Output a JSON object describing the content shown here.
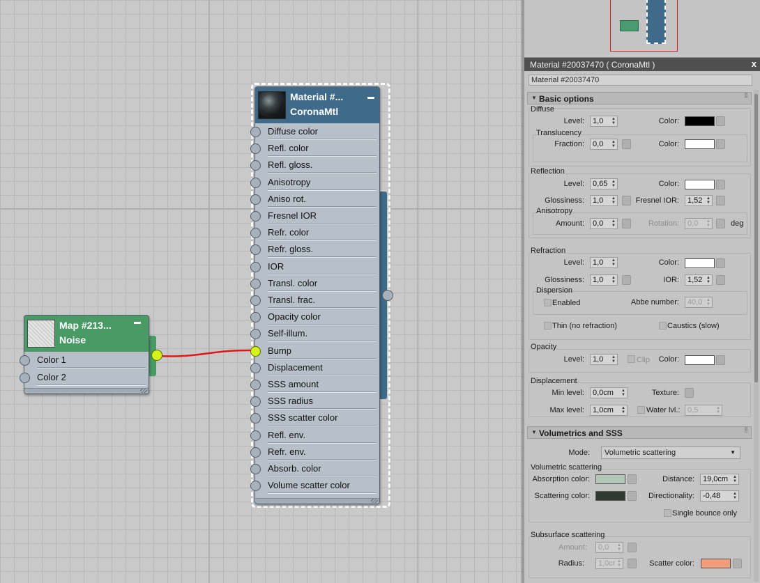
{
  "material_node": {
    "title": "Material  #...",
    "subtitle": "CoronaMtl",
    "slots": [
      "Diffuse color",
      "Refl. color",
      "Refl. gloss.",
      "Anisotropy",
      "Aniso rot.",
      "Fresnel IOR",
      "Refr. color",
      "Refr. gloss.",
      "IOR",
      "Transl. color",
      "Transl. frac.",
      "Opacity color",
      "Self-illum.",
      "Bump",
      "Displacement",
      "SSS amount",
      "SSS radius",
      "SSS scatter color",
      "Refl. env.",
      "Refr. env.",
      "Absorb. color",
      "Volume scatter color"
    ],
    "connected_slot": "Bump"
  },
  "map_node": {
    "title": "Map  #213...",
    "subtitle": "Noise",
    "slots": [
      "Color 1",
      "Color 2"
    ]
  },
  "panel": {
    "title": "Material #20037470  ( CoronaMtl )",
    "close_glyph": "x",
    "material_name": "Material #20037470",
    "basic": {
      "title": "Basic options",
      "diffuse": {
        "header": "Diffuse",
        "level_label": "Level:",
        "level": "1,0",
        "color_label": "Color:",
        "color": "#000000"
      },
      "translucency": {
        "header": "Translucency",
        "fraction_label": "Fraction:",
        "fraction": "0,0",
        "color_label": "Color:",
        "color": "#ffffff"
      },
      "reflection": {
        "header": "Reflection",
        "level_label": "Level:",
        "level": "0,65",
        "color_label": "Color:",
        "color": "#ffffff",
        "gloss_label": "Glossiness:",
        "gloss": "1,0",
        "fresnel_label": "Fresnel IOR:",
        "fresnel": "1,52"
      },
      "anisotropy": {
        "header": "Anisotropy",
        "amount_label": "Amount:",
        "amount": "0,0",
        "rotation_label": "Rotation:",
        "rotation": "0,0",
        "unit": "deg"
      },
      "refraction": {
        "header": "Refraction",
        "level_label": "Level:",
        "level": "1,0",
        "color_label": "Color:",
        "color": "#ffffff",
        "gloss_label": "Glossiness:",
        "gloss": "1,0",
        "ior_label": "IOR:",
        "ior": "1,52"
      },
      "dispersion": {
        "header": "Dispersion",
        "enabled_label": "Enabled",
        "abbe_label": "Abbe number:",
        "abbe": "40,0"
      },
      "thin_label": "Thin (no refraction)",
      "caustics_label": "Caustics (slow)",
      "opacity": {
        "header": "Opacity",
        "level_label": "Level:",
        "level": "1,0",
        "clip_label": "Clip",
        "color_label": "Color:",
        "color": "#ffffff"
      },
      "displacement": {
        "header": "Displacement",
        "min_label": "Min level:",
        "min": "0,0cm",
        "texture_label": "Texture:",
        "max_label": "Max level:",
        "max": "1,0cm",
        "water_label": "Water lvl.:",
        "water": "0,5"
      }
    },
    "volumetrics": {
      "title": "Volumetrics and SSS",
      "mode_label": "Mode:",
      "mode": "Volumetric scattering",
      "vol_header": "Volumetric scattering",
      "absorption_label": "Absorption color:",
      "absorption_color": "#b5c7b8",
      "distance_label": "Distance:",
      "distance": "19,0cm",
      "scattering_label": "Scattering color:",
      "scattering_color": "#2f3a33",
      "direction_label": "Directionality:",
      "direction": "-0,48",
      "single_bounce_label": "Single bounce only",
      "sss_header": "Subsurface scattering",
      "amount_label": "Amount:",
      "amount": "0,0",
      "radius_label": "Radius:",
      "radius": "1,0cr",
      "scatter_color_label": "Scatter color:",
      "scatter_color": "#f49c7a"
    }
  }
}
